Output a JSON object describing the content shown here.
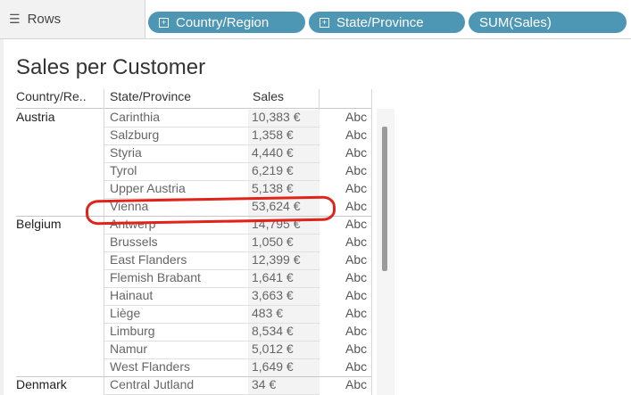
{
  "shelf": {
    "label": "Rows",
    "pills": [
      {
        "label": "Country/Region"
      },
      {
        "label": "State/Province"
      },
      {
        "label": "SUM(Sales)"
      }
    ]
  },
  "sheet": {
    "title": "Sales per Customer",
    "columns": {
      "country": "Country/Re..",
      "state": "State/Province",
      "sales": "Sales"
    },
    "rows": [
      {
        "country": "Austria",
        "state": "Carinthia",
        "sales": "10,383 €",
        "abc": "Abc"
      },
      {
        "country": "",
        "state": "Salzburg",
        "sales": "1,358 €",
        "abc": "Abc"
      },
      {
        "country": "",
        "state": "Styria",
        "sales": "4,440 €",
        "abc": "Abc"
      },
      {
        "country": "",
        "state": "Tyrol",
        "sales": "6,219 €",
        "abc": "Abc"
      },
      {
        "country": "",
        "state": "Upper Austria",
        "sales": "5,138 €",
        "abc": "Abc"
      },
      {
        "country": "",
        "state": "Vienna",
        "sales": "53,624 €",
        "abc": "Abc"
      },
      {
        "country": "Belgium",
        "state": "Antwerp",
        "sales": "14,795 €",
        "abc": "Abc"
      },
      {
        "country": "",
        "state": "Brussels",
        "sales": "1,050 €",
        "abc": "Abc"
      },
      {
        "country": "",
        "state": "East Flanders",
        "sales": "12,399 €",
        "abc": "Abc"
      },
      {
        "country": "",
        "state": "Flemish Brabant",
        "sales": "1,641 €",
        "abc": "Abc"
      },
      {
        "country": "",
        "state": "Hainaut",
        "sales": "3,663 €",
        "abc": "Abc"
      },
      {
        "country": "",
        "state": "Liège",
        "sales": "483 €",
        "abc": "Abc"
      },
      {
        "country": "",
        "state": "Limburg",
        "sales": "8,534 €",
        "abc": "Abc"
      },
      {
        "country": "",
        "state": "Namur",
        "sales": "5,012 €",
        "abc": "Abc"
      },
      {
        "country": "",
        "state": "West Flanders",
        "sales": "1,649 €",
        "abc": "Abc"
      },
      {
        "country": "Denmark",
        "state": "Central Jutland",
        "sales": "34 €",
        "abc": "Abc"
      }
    ]
  },
  "icons": {
    "rows": "rows-list-icon",
    "pill_expand": "plus-box-icon"
  }
}
